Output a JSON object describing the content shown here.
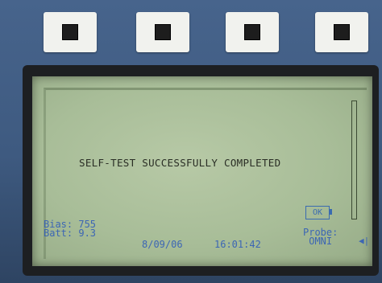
{
  "softkeys": [
    "softkey-1",
    "softkey-2",
    "softkey-3",
    "softkey-4"
  ],
  "screen": {
    "message": "SELF-TEST SUCCESSFULLY COMPLETED",
    "battery_label": "OK",
    "bias_label": "Bias:",
    "bias_value": "755",
    "batt_label": "Batt:",
    "batt_value": "9.3",
    "date": "8/09/06",
    "time": "16:01:42",
    "probe_label": "Probe:",
    "probe_value": "OMNI",
    "speaker_icon": "speaker-icon"
  },
  "colors": {
    "lcd": "#aabf9a",
    "text_dark": "#2a2e25",
    "text_blue": "#3c66b4",
    "case": "#3e5a80"
  }
}
